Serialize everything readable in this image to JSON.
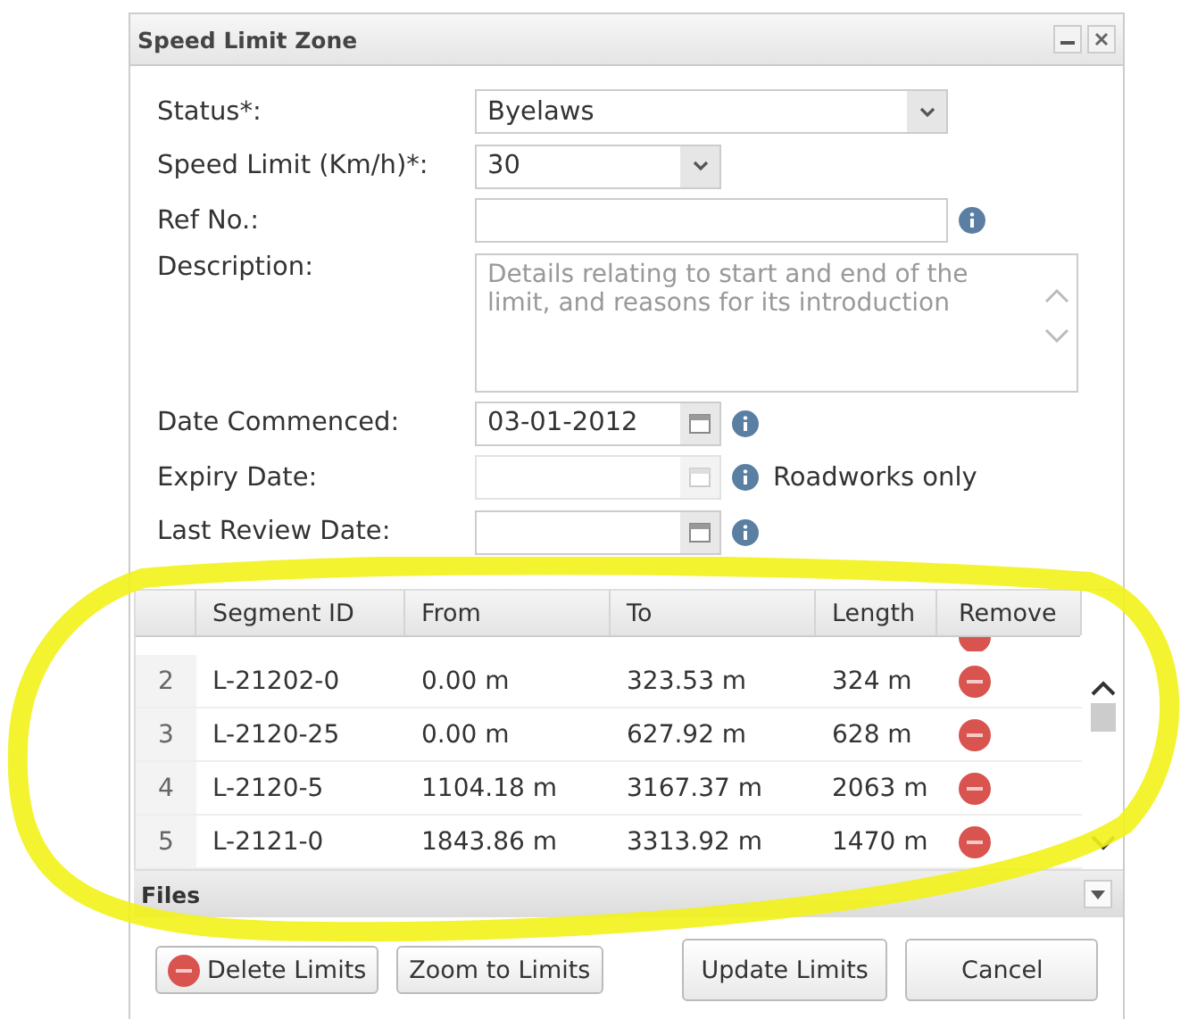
{
  "window": {
    "title": "Speed Limit Zone"
  },
  "form": [
    {
      "kind": "select",
      "label": "Status*:",
      "value": "Byelaws",
      "wide": true
    },
    {
      "kind": "select",
      "label": "Speed Limit (Km/h)*:",
      "value": "30",
      "wide": false
    },
    {
      "kind": "text",
      "label": "Ref No.:",
      "info": true
    },
    {
      "kind": "textarea",
      "label": "Description:",
      "placeholder": "Details relating to start and end of the limit, and reasons for its introduction"
    },
    {
      "kind": "date",
      "label": "Date Commenced:",
      "value": "03-01-2012",
      "info": true,
      "disabled": false
    },
    {
      "kind": "date",
      "label": "Expiry Date:",
      "info": true,
      "note": "Roadworks only",
      "disabled": true
    },
    {
      "kind": "date",
      "label": "Last Review Date:",
      "info": true,
      "disabled": false
    }
  ],
  "table": {
    "columns": [
      "Segment ID",
      "From",
      "To",
      "Length",
      "Remove"
    ],
    "rows": [
      {
        "number": "2",
        "segment_id": "L-21202-0",
        "from": "0.00 m",
        "to": "323.53 m",
        "length": "324 m"
      },
      {
        "number": "3",
        "segment_id": "L-2120-25",
        "from": "0.00 m",
        "to": "627.92 m",
        "length": "628 m"
      },
      {
        "number": "4",
        "segment_id": "L-2120-5",
        "from": "1104.18 m",
        "to": "3167.37 m",
        "length": "2063 m"
      },
      {
        "number": "5",
        "segment_id": "L-2121-0",
        "from": "1843.86 m",
        "to": "3313.92 m",
        "length": "1470 m"
      }
    ]
  },
  "files_panel": {
    "title": "Files",
    "expanded": false
  },
  "buttons": [
    {
      "label": "Delete Limits",
      "kind": "delete"
    },
    {
      "label": "Zoom to Limits",
      "kind": "plain"
    },
    {
      "label": "Update Limits",
      "kind": "primary"
    },
    {
      "label": "Cancel",
      "kind": "primary"
    }
  ]
}
